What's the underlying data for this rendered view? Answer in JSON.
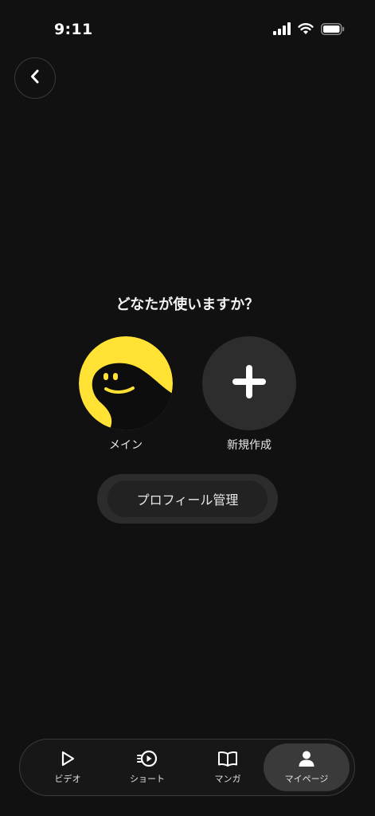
{
  "status_bar": {
    "time": "9:11",
    "icons": [
      "signal-icon",
      "wifi-icon",
      "battery-icon"
    ]
  },
  "header": {
    "back_icon": "chevron-left-icon"
  },
  "main": {
    "question": "どなたが使いますか？",
    "profiles": [
      {
        "label": "メイン",
        "icon": "smiley-avatar-icon",
        "avatar_color": "#ffe234"
      },
      {
        "label": "新規作成",
        "icon": "plus-icon"
      }
    ],
    "manage_label": "プロフィール管理"
  },
  "bottom_nav": {
    "items": [
      {
        "label": "ビデオ",
        "icon": "play-icon",
        "active": false
      },
      {
        "label": "ショート",
        "icon": "short-play-icon",
        "active": false
      },
      {
        "label": "マンガ",
        "icon": "book-icon",
        "active": false
      },
      {
        "label": "マイページ",
        "icon": "person-icon",
        "active": true
      }
    ]
  },
  "colors": {
    "background": "#111111",
    "accent_yellow": "#ffe234",
    "active_tab": "#3a3a3a"
  }
}
